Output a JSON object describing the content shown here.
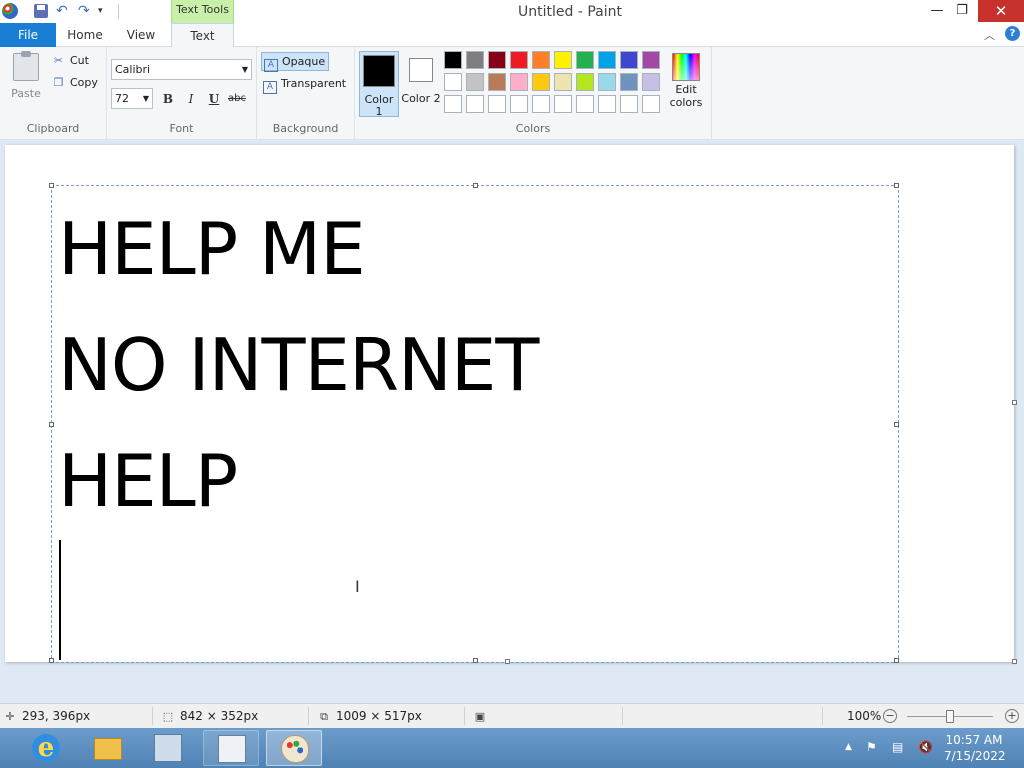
{
  "window": {
    "title": "Untitled - Paint",
    "context_tab": "Text Tools",
    "minimize": "—",
    "maximize": "❐",
    "close": "✕"
  },
  "tabs": {
    "file": "File",
    "home": "Home",
    "view": "View",
    "text": "Text"
  },
  "ribbon": {
    "clipboard": {
      "label": "Clipboard",
      "paste": "Paste",
      "cut": "Cut",
      "copy": "Copy"
    },
    "font": {
      "label": "Font",
      "family": "Calibri",
      "size": "72",
      "bold": "B",
      "italic": "I",
      "underline": "U",
      "strikethrough": "abc"
    },
    "background": {
      "label": "Background",
      "opaque": "Opaque",
      "transparent": "Transparent"
    },
    "colors": {
      "label": "Colors",
      "color1": "Color 1",
      "color2": "Color 2",
      "edit_colors": "Edit colors",
      "color1_value": "#000000",
      "color2_value": "#ffffff",
      "palette_row1": [
        "#000000",
        "#7f7f7f",
        "#880015",
        "#ed1c24",
        "#ff7f27",
        "#fff200",
        "#22b14c",
        "#00a2e8",
        "#3f48cc",
        "#a349a4"
      ],
      "palette_row2": [
        "#ffffff",
        "#c3c3c3",
        "#b97a57",
        "#ffaec9",
        "#ffc90e",
        "#efe4b0",
        "#b5e61d",
        "#99d9ea",
        "#7092be",
        "#c8bfe7"
      ],
      "palette_row3": [
        "#ffffff",
        "#ffffff",
        "#ffffff",
        "#ffffff",
        "#ffffff",
        "#ffffff",
        "#ffffff",
        "#ffffff",
        "#ffffff",
        "#ffffff"
      ]
    }
  },
  "canvas": {
    "lines": [
      "HELP ME",
      "NO INTERNET",
      "HELP"
    ]
  },
  "statusbar": {
    "cursor_pos": "293, 396px",
    "selection_size": "842 × 352px",
    "canvas_size": "1009 × 517px",
    "zoom": "100%",
    "zoom_minus": "−",
    "zoom_plus": "+",
    "zoom_level": 0.5
  },
  "taskbar": {
    "time": "10:57 AM",
    "date": "7/15/2022",
    "ie_glyph": "e"
  }
}
